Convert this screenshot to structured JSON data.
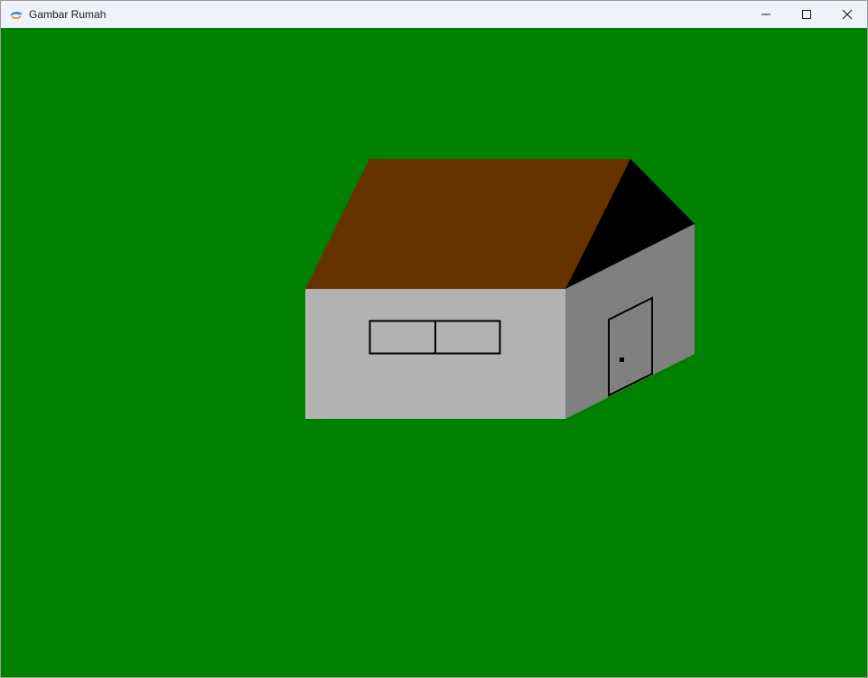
{
  "window": {
    "title": "Gambar Rumah",
    "controls": {
      "minimize_icon": "minimize-icon",
      "maximize_icon": "maximize-icon",
      "close_icon": "close-icon"
    }
  },
  "scene": {
    "background_color": "#008000",
    "house": {
      "roof_color": "#663300",
      "gable_color": "#000000",
      "front_wall_color": "#b2b2b2",
      "side_wall_color": "#808080",
      "outline_color": "#000000"
    }
  }
}
